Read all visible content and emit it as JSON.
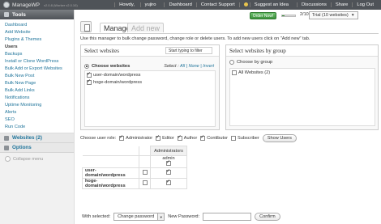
{
  "topbar": {
    "brand": "ManageWP",
    "version": "v2.0.8 (Worker v2.0.10)",
    "howdy": "Howdy,",
    "user": "yujiro",
    "nav": [
      "Dashboard",
      "Contact Support",
      "Suggest an Idea",
      "Discussions",
      "Share",
      "Log Out"
    ]
  },
  "sidebar": {
    "tools_title": "Tools",
    "items": [
      "Dashboard",
      "Add Website",
      "Plugins & Themes",
      "Users",
      "Backups",
      "Install or Clone WordPress",
      "Bulk Add or Export Websites",
      "Bulk New Post",
      "Bulk New Page",
      "Bulk Add Links",
      "Notifications",
      "Uptime Monitoring",
      "Alerts",
      "SEO",
      "Run Code"
    ],
    "current_item": "Users",
    "websites": "Websites (2)",
    "options": "Options",
    "collapse": "Collapse menu"
  },
  "header": {
    "order_now": "Order Now!",
    "counter": "2/10",
    "trial": "Trial (10 websites)",
    "trial_fraction": 0.2
  },
  "tabs": {
    "manage": "Manage",
    "add_new": "Add new"
  },
  "intro": "Use this manager to bulk change password, change role or delete users. To add new users click on \"Add new\" tab.",
  "select_websites": {
    "title": "Select websites",
    "filter_placeholder": "Start typing to filter",
    "choose_label": "Choose websites",
    "select_label": "Select :",
    "all": "All",
    "none": "None",
    "invert": "Invert",
    "sites": [
      {
        "name": "user-domain/wordpress",
        "checked": true
      },
      {
        "name": "hoge-domain/wordpress",
        "checked": true
      }
    ]
  },
  "select_group": {
    "title": "Select websites by group",
    "choose_label": "Choose by group",
    "groups": [
      {
        "name": "All Websites (2)",
        "checked": false
      }
    ]
  },
  "roles": {
    "label": "Choose user role:",
    "items": [
      {
        "name": "Administrator",
        "checked": true
      },
      {
        "name": "Editor",
        "checked": true
      },
      {
        "name": "Author",
        "checked": true
      },
      {
        "name": "Contibutor",
        "checked": true
      },
      {
        "name": "Subscriber",
        "checked": false
      }
    ],
    "show_users": "Show Users"
  },
  "table": {
    "header": "Administrators",
    "user": "admin",
    "rows": [
      {
        "site": "user-domain/wordpress",
        "selected": false,
        "user_checked": true
      },
      {
        "site": "hoge-domain/wordpress",
        "selected": false,
        "user_checked": true
      }
    ]
  },
  "bottom": {
    "with_selected": "With selected:",
    "action": "Change password",
    "new_password": "New Password:",
    "password_value": "",
    "confirm": "Confirm"
  }
}
